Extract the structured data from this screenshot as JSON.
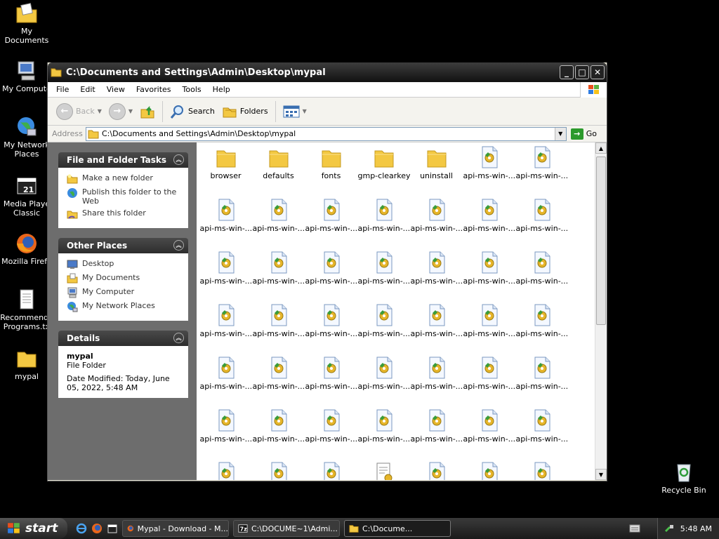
{
  "desktop": {
    "icons": [
      {
        "label": "My Documents"
      },
      {
        "label": "My Compute"
      },
      {
        "label": "My Network\nPlaces"
      },
      {
        "label": "Media Playe\nClassic"
      },
      {
        "label": "Mozilla Firefo"
      },
      {
        "label": "Recommende\nPrograms.tx"
      },
      {
        "label": "mypal"
      },
      {
        "label": "Recycle Bin"
      }
    ]
  },
  "window": {
    "title": "C:\\Documents and Settings\\Admin\\Desktop\\mypal",
    "menu": [
      "File",
      "Edit",
      "View",
      "Favorites",
      "Tools",
      "Help"
    ],
    "toolbar": {
      "back": "Back",
      "search": "Search",
      "folders": "Folders"
    },
    "address": {
      "label": "Address",
      "value": "C:\\Documents and Settings\\Admin\\Desktop\\mypal",
      "go": "Go"
    },
    "task_pane": {
      "file_folder_tasks": {
        "title": "File and Folder Tasks",
        "items": [
          "Make a new folder",
          "Publish this folder to the Web",
          "Share this folder"
        ]
      },
      "other_places": {
        "title": "Other Places",
        "items": [
          "Desktop",
          "My Documents",
          "My Computer",
          "My Network Places"
        ]
      },
      "details": {
        "title": "Details",
        "name": "mypal",
        "type": "File Folder",
        "modified": "Date Modified: Today, June 05, 2022, 5:48 AM"
      }
    },
    "files": [
      {
        "name": "browser",
        "kind": "folder"
      },
      {
        "name": "defaults",
        "kind": "folder"
      },
      {
        "name": "fonts",
        "kind": "folder"
      },
      {
        "name": "gmp-clearkey",
        "kind": "folder"
      },
      {
        "name": "uninstall",
        "kind": "folder"
      },
      {
        "name": "api-ms-win-...",
        "kind": "dll"
      },
      {
        "name": "api-ms-win-...",
        "kind": "dll"
      },
      {
        "name": "api-ms-win-...",
        "kind": "dll"
      },
      {
        "name": "api-ms-win-...",
        "kind": "dll"
      },
      {
        "name": "api-ms-win-...",
        "kind": "dll"
      },
      {
        "name": "api-ms-win-...",
        "kind": "dll"
      },
      {
        "name": "api-ms-win-...",
        "kind": "dll"
      },
      {
        "name": "api-ms-win-...",
        "kind": "dll"
      },
      {
        "name": "api-ms-win-...",
        "kind": "dll"
      },
      {
        "name": "api-ms-win-...",
        "kind": "dll"
      },
      {
        "name": "api-ms-win-...",
        "kind": "dll"
      },
      {
        "name": "api-ms-win-...",
        "kind": "dll"
      },
      {
        "name": "api-ms-win-...",
        "kind": "dll"
      },
      {
        "name": "api-ms-win-...",
        "kind": "dll"
      },
      {
        "name": "api-ms-win-...",
        "kind": "dll"
      },
      {
        "name": "api-ms-win-...",
        "kind": "dll"
      },
      {
        "name": "api-ms-win-...",
        "kind": "dll"
      },
      {
        "name": "api-ms-win-...",
        "kind": "dll"
      },
      {
        "name": "api-ms-win-...",
        "kind": "dll"
      },
      {
        "name": "api-ms-win-...",
        "kind": "dll"
      },
      {
        "name": "api-ms-win-...",
        "kind": "dll"
      },
      {
        "name": "api-ms-win-...",
        "kind": "dll"
      },
      {
        "name": "api-ms-win-...",
        "kind": "dll"
      },
      {
        "name": "api-ms-win-...",
        "kind": "dll"
      },
      {
        "name": "api-ms-win-...",
        "kind": "dll"
      },
      {
        "name": "api-ms-win-...",
        "kind": "dll"
      },
      {
        "name": "api-ms-win-...",
        "kind": "dll"
      },
      {
        "name": "api-ms-win-...",
        "kind": "dll"
      },
      {
        "name": "api-ms-win-...",
        "kind": "dll"
      },
      {
        "name": "api-ms-win-...",
        "kind": "dll"
      },
      {
        "name": "api-ms-win-...",
        "kind": "dll"
      },
      {
        "name": "api-ms-win-...",
        "kind": "dll"
      },
      {
        "name": "api-ms-win-...",
        "kind": "dll"
      },
      {
        "name": "api-ms-win-...",
        "kind": "dll"
      },
      {
        "name": "api-ms-win-...",
        "kind": "dll"
      },
      {
        "name": "api-ms-win-...",
        "kind": "dll"
      },
      {
        "name": "api-ms-win-...",
        "kind": "dll"
      },
      {
        "name": "",
        "kind": "dll"
      },
      {
        "name": "",
        "kind": "dll"
      },
      {
        "name": "",
        "kind": "dll"
      },
      {
        "name": "",
        "kind": "config"
      },
      {
        "name": "",
        "kind": "dll"
      },
      {
        "name": "",
        "kind": "dll"
      },
      {
        "name": "",
        "kind": "dll"
      }
    ]
  },
  "taskbar": {
    "start": "start",
    "buttons": [
      {
        "label": "Mypal - Download - M..."
      },
      {
        "label": "C:\\DOCUME~1\\Admi..."
      },
      {
        "label": "C:\\Docume..."
      }
    ],
    "clock": "5:48 AM"
  },
  "colors": {
    "desktop": "#000000",
    "folder": "#f3c842",
    "taskpane": "#6d6d6d"
  }
}
